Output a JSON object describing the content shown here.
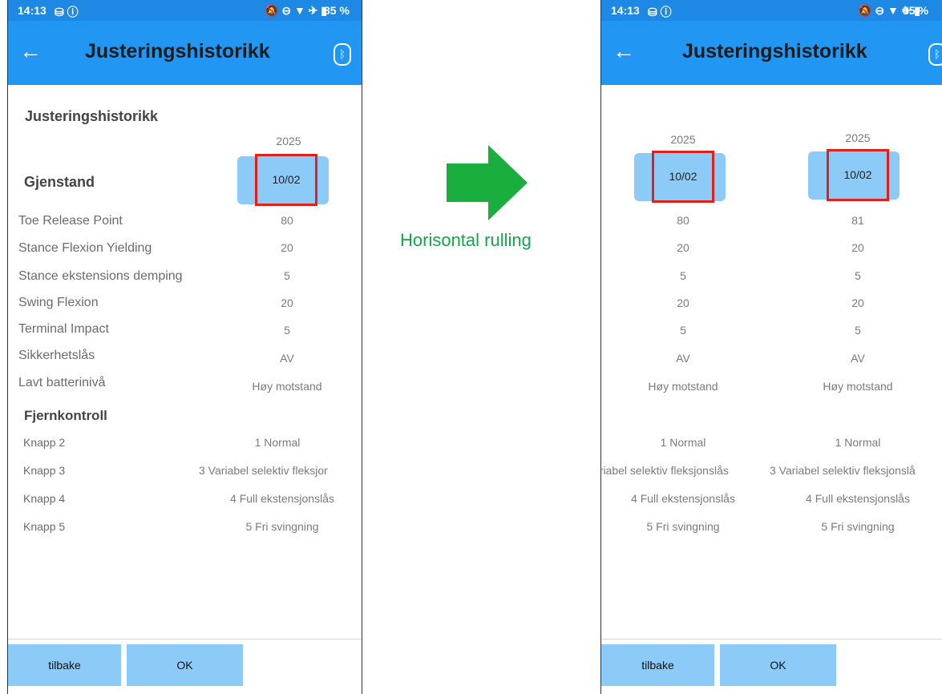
{
  "status": {
    "time": "14:13",
    "left_icons": "⛁ ⓘ",
    "right_icons": "🔕 ⊖ ▼ ✈ ▮",
    "battery": "85 %"
  },
  "appbar": {
    "title": "Justeringshistorikk"
  },
  "left": {
    "section_title": "Justeringshistorikk",
    "year": "2025",
    "item_header": "Gjenstand",
    "date": "10/02",
    "rows": [
      {
        "label": "Toe Release Point",
        "value": "80"
      },
      {
        "label": "Stance Flexion Yielding",
        "value": "20"
      },
      {
        "label": "Stance ekstensions demping",
        "value": "5"
      },
      {
        "label": "Swing Flexion",
        "value": "20"
      },
      {
        "label": "Terminal Impact",
        "value": "5"
      },
      {
        "label": "Sikkerhetslås",
        "value": "AV"
      },
      {
        "label": "Lavt batterinivå",
        "value": "Høy motstand"
      }
    ],
    "remote_title": "Fjernkontroll",
    "remote": [
      {
        "label": "Knapp 2",
        "value": "1 Normal"
      },
      {
        "label": "Knapp 3",
        "value": "3 Variabel selektiv fleksjor"
      },
      {
        "label": "Knapp 4",
        "value": "4 Full ekstensjonslås"
      },
      {
        "label": "Knapp 5",
        "value": "5 Fri svingning"
      }
    ]
  },
  "right": {
    "col1": {
      "year": "2025",
      "date": "10/02",
      "values": [
        "80",
        "20",
        "5",
        "20",
        "5",
        "AV",
        "Høy motstand"
      ],
      "remote": [
        "1 Normal",
        "ariabel selektiv fleksjonslås",
        "4 Full ekstensjonslås",
        "5 Fri svingning"
      ]
    },
    "col2": {
      "year": "2025",
      "date": "10/02",
      "values": [
        "81",
        "20",
        "5",
        "20",
        "5",
        "AV",
        "Høy motstand"
      ],
      "remote": [
        "1 Normal",
        "3 Variabel selektiv fleksjonslå",
        "4 Full ekstensjonslås",
        "5 Fri svingning"
      ]
    }
  },
  "buttons": {
    "back": "tilbake",
    "ok": "OK"
  },
  "arrow_label": "Horisontal rulling",
  "colors": {
    "status_bar": "#1e88e5",
    "app_bar": "#2196f3",
    "button": "#8ccaf7",
    "highlight": "#e0201b",
    "arrow": "#1aae3f"
  }
}
